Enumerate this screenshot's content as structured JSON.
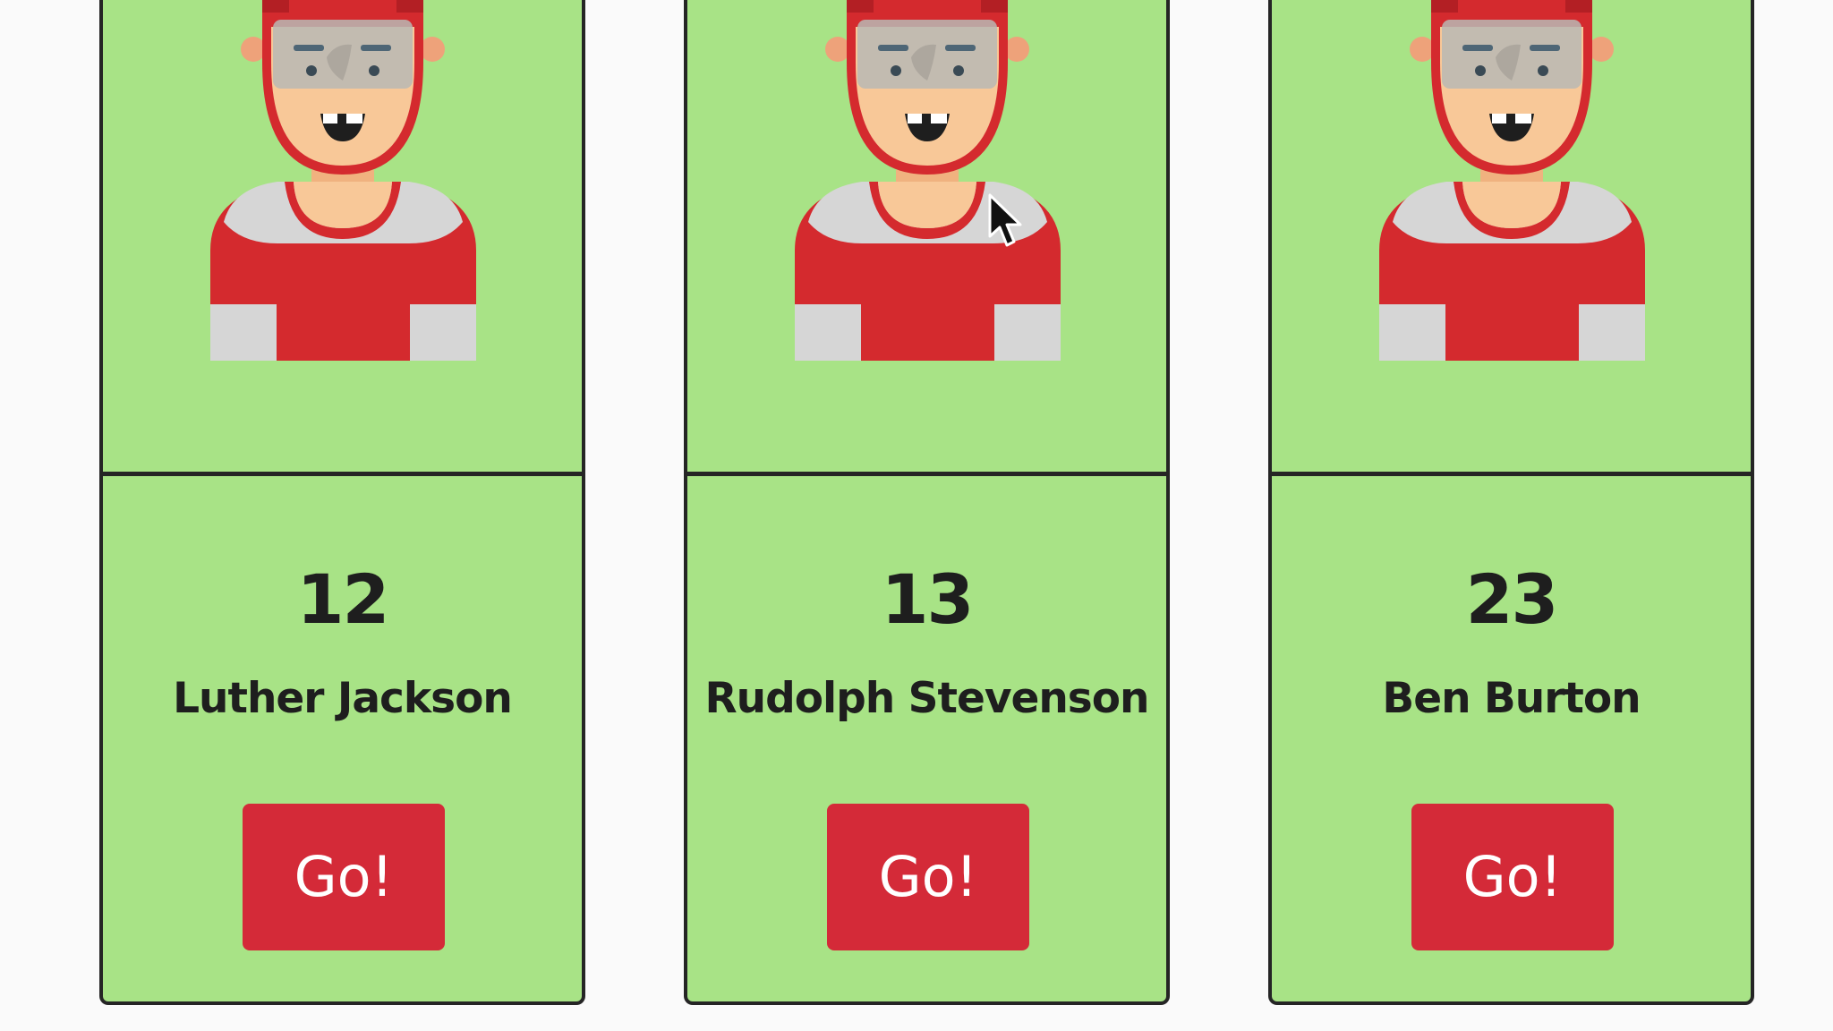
{
  "players": [
    {
      "number": "12",
      "name": "Luther Jackson",
      "button_label": "Go!"
    },
    {
      "number": "13",
      "name": "Rudolph Stevenson",
      "button_label": "Go!"
    },
    {
      "number": "23",
      "name": "Ben Burton",
      "button_label": "Go!"
    }
  ],
  "colors": {
    "card_background": "#a8e386",
    "card_border": "#252525",
    "button": "#d42a38",
    "helmet_and_jersey": "#d42a2e",
    "jersey_trim": "#d8d8d8",
    "skin": "#f8c898",
    "page_background": "#fafafa"
  },
  "icons": {
    "avatar": "hockey-player-avatar-icon",
    "cursor": "mouse-pointer-icon"
  }
}
